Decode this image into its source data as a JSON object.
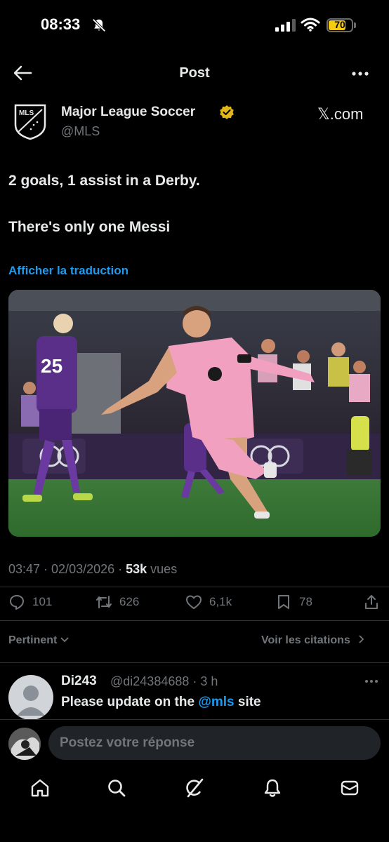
{
  "status_bar": {
    "time": "08:33",
    "battery": "70",
    "battery_color": "#f5cc14"
  },
  "header": {
    "title": "Post",
    "back_icon": "arrow-left-icon",
    "more_icon": "more-horizontal-icon"
  },
  "post": {
    "author_name": "Major League Soccer",
    "author_handle": "@MLS",
    "source": "𝕏.com",
    "verified_color": "#e2b719",
    "text_line1": "2 goals, 1 assist in a Derby.",
    "text_line2": "There's only one Messi",
    "translate_label": "Afficher la traduction",
    "timestamp": "03:47 · 02/03/2026 · ",
    "views_count": "53k",
    "views_label": " vues",
    "media_description": "Football player in a pink jersey celebrating on the pitch"
  },
  "actions": {
    "replies": "101",
    "reposts": "626",
    "likes": "6,1k",
    "bookmarks": "78"
  },
  "filters": {
    "sort": "Pertinent",
    "quotes": "Voir les citations"
  },
  "reply": {
    "name": "Di243",
    "handle": "@di24384688 · 3 h",
    "text_before": "Please update on the ",
    "mention": "@mls",
    "text_after": " site"
  },
  "compose": {
    "placeholder": "Postez votre réponse"
  },
  "nav": [
    "home-icon",
    "search-icon",
    "grok-icon",
    "notifications-icon",
    "messages-icon"
  ],
  "colors": {
    "accent": "#1d9bf0",
    "muted": "#71767b",
    "text": "#e7e9ea",
    "background": "#000000"
  }
}
